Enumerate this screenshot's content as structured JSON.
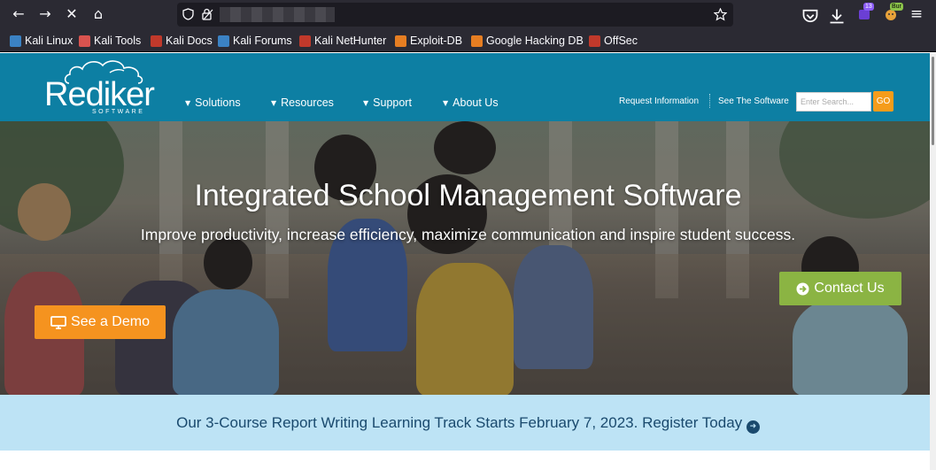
{
  "browser": {
    "nav": {
      "back": "←",
      "forward": "→",
      "stop": "✕",
      "home": "⌂"
    },
    "url_icons": {
      "shield": "shield-icon",
      "lock": "lock-icon",
      "star": "★"
    },
    "toolbar": {
      "ext1_badge": "13",
      "ext2_badge": "Bur",
      "menu": "≡"
    },
    "bookmarks": [
      {
        "label": "Kali Linux",
        "icon": "kali-icon",
        "color": "#3b82c4"
      },
      {
        "label": "Kali Tools",
        "icon": "kali-tools-icon",
        "color": "#d9534f"
      },
      {
        "label": "Kali Docs",
        "icon": "kali-docs-icon",
        "color": "#c0392b"
      },
      {
        "label": "Kali Forums",
        "icon": "kali-forums-icon",
        "color": "#3b82c4"
      },
      {
        "label": "Kali NetHunter",
        "icon": "nethunter-icon",
        "color": "#c0392b"
      },
      {
        "label": "Exploit-DB",
        "icon": "exploitdb-icon",
        "color": "#e67e22"
      },
      {
        "label": "Google Hacking DB",
        "icon": "ghdb-icon",
        "color": "#e67e22"
      },
      {
        "label": "OffSec",
        "icon": "offsec-icon",
        "color": "#c0392b"
      }
    ]
  },
  "site": {
    "logo": {
      "name": "Rediker",
      "tagline": "SOFTWARE"
    },
    "nav": [
      {
        "label": "Solutions"
      },
      {
        "label": "Resources"
      },
      {
        "label": "Support"
      },
      {
        "label": "About Us"
      }
    ],
    "utility": {
      "request_info": "Request Information",
      "see_software": "See The Software",
      "search_placeholder": "Enter Search...",
      "go": "GO"
    },
    "hero": {
      "title": "Integrated School Management Software",
      "subtitle": "Improve productivity, increase efficiency, maximize communication and inspire student success.",
      "demo_button": "See a Demo",
      "contact_button": "Contact Us"
    },
    "announcement": {
      "text": "Our 3-Course Report Writing Learning Track Starts February 7, 2023. Register Today"
    },
    "colors": {
      "header": "#0d7fa3",
      "demo": "#f5931f",
      "contact": "#8bb443",
      "go": "#f59c1a",
      "announcement_bg": "#bde3f5"
    }
  }
}
